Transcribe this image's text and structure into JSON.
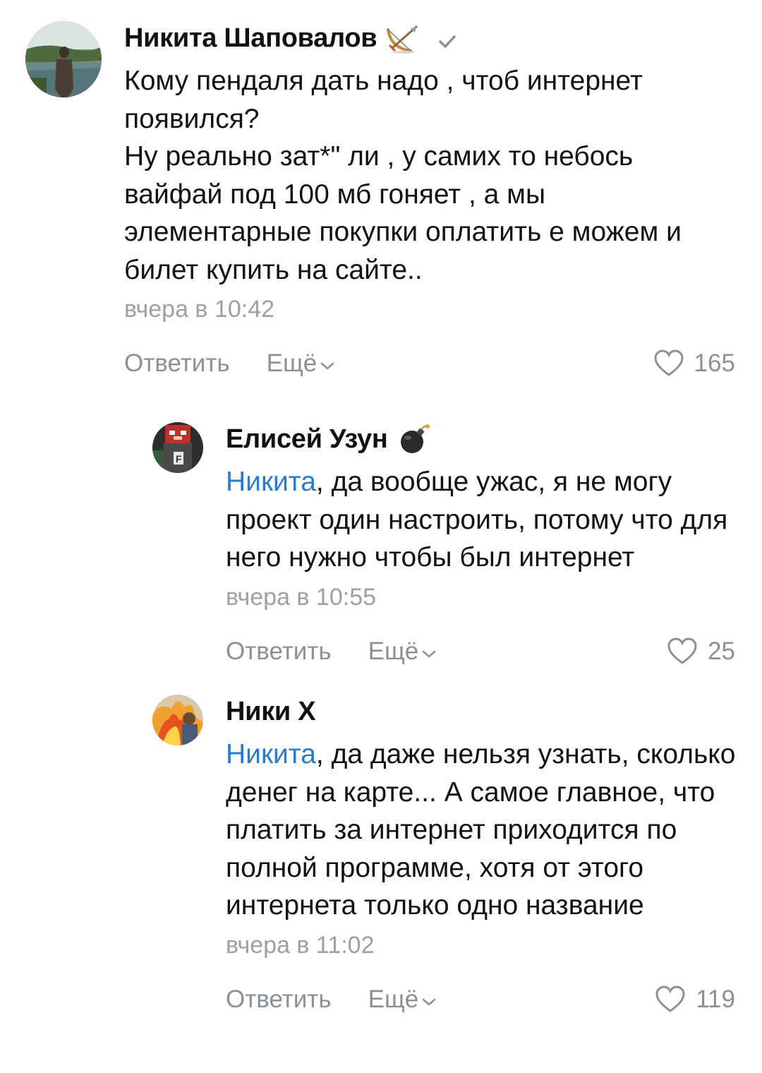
{
  "comments": [
    {
      "author": "Никита Шаповалов",
      "badge_icon": "bow-arrow-emoji",
      "verified": true,
      "mention": "",
      "text": "Кому пендаля дать надо , чтоб интернет появился?\nНу реально зат*\" ли , у самих то небось вайфай под 100 мб гоняет , а мы элементарные покупки оплатить е можем и билет купить на сайте..",
      "time": "вчера в 10:42",
      "reply_label": "Ответить",
      "more_label": "Ещё",
      "likes": "165"
    },
    {
      "author": "Елисей Узун",
      "badge_icon": "bomb-emoji",
      "verified": false,
      "mention": "Никита",
      "text": ", да вообще ужас, я не могу проект один настроить, потому что для него нужно чтобы был интернет",
      "time": "вчера в 10:55",
      "reply_label": "Ответить",
      "more_label": "Ещё",
      "likes": "25"
    },
    {
      "author": "Ники Х",
      "badge_icon": "",
      "verified": false,
      "mention": "Никита",
      "text": ", да даже нельзя узнать, сколько денег на карте... А самое главное, что платить за интернет приходится по полной программе, хотя от этого интернета только одно название",
      "time": "вчера в 11:02",
      "reply_label": "Ответить",
      "more_label": "Ещё",
      "likes": "119"
    }
  ],
  "colors": {
    "text": "#111111",
    "mention": "#2b7ad1",
    "muted": "#8a9097",
    "time": "#9aa0a6"
  }
}
